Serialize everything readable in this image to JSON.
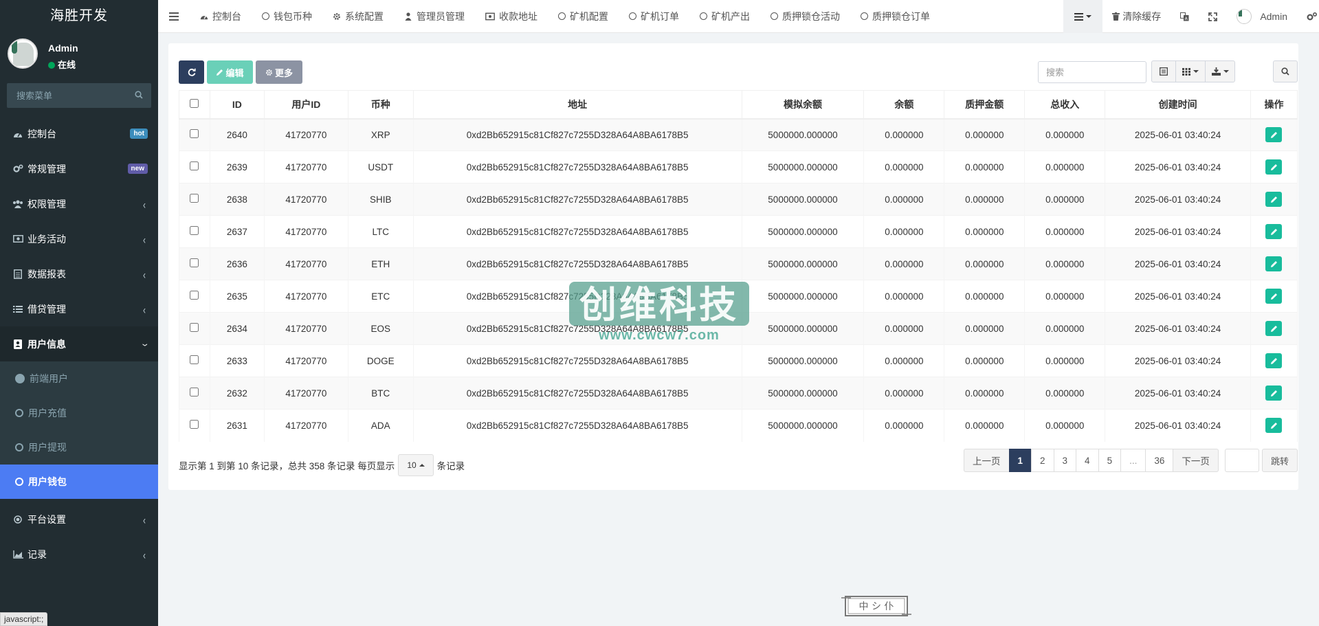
{
  "sidebar": {
    "logo": "海胜开发",
    "user": {
      "name": "Admin",
      "status": "在线"
    },
    "search_placeholder": "搜索菜单",
    "menu": [
      {
        "label": "控制台",
        "badge": "hot"
      },
      {
        "label": "常规管理",
        "badge": "new"
      },
      {
        "label": "权限管理"
      },
      {
        "label": "业务活动"
      },
      {
        "label": "数据报表"
      },
      {
        "label": "借贷管理"
      },
      {
        "label": "用户信息"
      },
      {
        "label": "平台设置"
      },
      {
        "label": "记录"
      }
    ],
    "submenu": [
      {
        "label": "前端用户"
      },
      {
        "label": "用户充值"
      },
      {
        "label": "用户提现"
      },
      {
        "label": "用户钱包"
      }
    ]
  },
  "navbar": {
    "tabs": [
      "控制台",
      "钱包币种",
      "系统配置",
      "管理员管理",
      "收款地址",
      "矿机配置",
      "矿机订单",
      "矿机产出",
      "质押锁仓活动",
      "质押锁仓订单"
    ],
    "clear_cache": "清除缓存",
    "admin": "Admin"
  },
  "toolbar": {
    "edit_label": "编辑",
    "more_label": "更多",
    "search_placeholder": "搜索"
  },
  "table": {
    "headers": [
      "ID",
      "用户ID",
      "币种",
      "地址",
      "模拟余额",
      "余额",
      "质押金额",
      "总收入",
      "创建时间",
      "操作"
    ],
    "rows": [
      [
        "2640",
        "41720770",
        "XRP",
        "0xd2Bb652915c81Cf827c7255D328A64A8BA6178B5",
        "5000000.000000",
        "0.000000",
        "0.000000",
        "0.000000",
        "2025-06-01 03:40:24"
      ],
      [
        "2639",
        "41720770",
        "USDT",
        "0xd2Bb652915c81Cf827c7255D328A64A8BA6178B5",
        "5000000.000000",
        "0.000000",
        "0.000000",
        "0.000000",
        "2025-06-01 03:40:24"
      ],
      [
        "2638",
        "41720770",
        "SHIB",
        "0xd2Bb652915c81Cf827c7255D328A64A8BA6178B5",
        "5000000.000000",
        "0.000000",
        "0.000000",
        "0.000000",
        "2025-06-01 03:40:24"
      ],
      [
        "2637",
        "41720770",
        "LTC",
        "0xd2Bb652915c81Cf827c7255D328A64A8BA6178B5",
        "5000000.000000",
        "0.000000",
        "0.000000",
        "0.000000",
        "2025-06-01 03:40:24"
      ],
      [
        "2636",
        "41720770",
        "ETH",
        "0xd2Bb652915c81Cf827c7255D328A64A8BA6178B5",
        "5000000.000000",
        "0.000000",
        "0.000000",
        "0.000000",
        "2025-06-01 03:40:24"
      ],
      [
        "2635",
        "41720770",
        "ETC",
        "0xd2Bb652915c81Cf827c7255D328A64A8BA6178B5",
        "5000000.000000",
        "0.000000",
        "0.000000",
        "0.000000",
        "2025-06-01 03:40:24"
      ],
      [
        "2634",
        "41720770",
        "EOS",
        "0xd2Bb652915c81Cf827c7255D328A64A8BA6178B5",
        "5000000.000000",
        "0.000000",
        "0.000000",
        "0.000000",
        "2025-06-01 03:40:24"
      ],
      [
        "2633",
        "41720770",
        "DOGE",
        "0xd2Bb652915c81Cf827c7255D328A64A8BA6178B5",
        "5000000.000000",
        "0.000000",
        "0.000000",
        "0.000000",
        "2025-06-01 03:40:24"
      ],
      [
        "2632",
        "41720770",
        "BTC",
        "0xd2Bb652915c81Cf827c7255D328A64A8BA6178B5",
        "5000000.000000",
        "0.000000",
        "0.000000",
        "0.000000",
        "2025-06-01 03:40:24"
      ],
      [
        "2631",
        "41720770",
        "ADA",
        "0xd2Bb652915c81Cf827c7255D328A64A8BA6178B5",
        "5000000.000000",
        "0.000000",
        "0.000000",
        "0.000000",
        "2025-06-01 03:40:24"
      ]
    ]
  },
  "pager": {
    "info_prefix": "显示第 1 到第 10 条记录，总共 358 条记录 每页显示",
    "page_size": "10",
    "info_suffix": "条记录",
    "prev": "上一页",
    "pages": [
      "1",
      "2",
      "3",
      "4",
      "5",
      "...",
      "36"
    ],
    "next": "下一页",
    "goto": "跳转"
  },
  "watermark": {
    "text": "创维科技",
    "url": "www.cwcw7.com"
  },
  "stamp_text": "中 シ 仆",
  "status_bar": "javascript:;",
  "colors": {
    "sidebar_bg": "#222d32",
    "active_sub": "#4c7cf3",
    "primary": "#2c3e5e",
    "edit_green": "#18bc9c"
  }
}
